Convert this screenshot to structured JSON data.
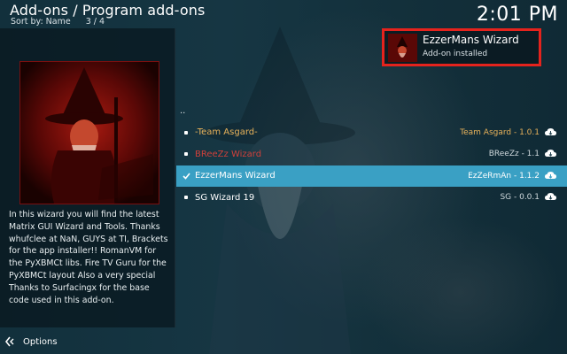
{
  "header": {
    "title": "Add-ons / Program add-ons",
    "sort_label": "Sort by: Name",
    "position": "3 / 4"
  },
  "clock": "2:01 PM",
  "selected_addon": {
    "description": "In this wizard you will find the latest Matrix GUI Wizard and Tools. Thanks whufclee at NaN, GUYS at TI, Brackets for the app installer!! RomanVM for the PyXBMCt libs. Fire TV Guru for the PyXBMCt layout  Also a very special Thanks to Surfacingx for the base code used in this add-on."
  },
  "list": {
    "parent": "..",
    "items": [
      {
        "name": "-Team Asgard-",
        "meta": "Team Asgard - 1.0.1",
        "state": "orange"
      },
      {
        "name": "BReeZz Wizard",
        "meta": "BReeZz - 1.1",
        "state": "red"
      },
      {
        "name": "EzzerMans Wizard",
        "meta": "EzZeRmAn - 1.1.2",
        "state": "selected"
      },
      {
        "name": "SG Wizard 19",
        "meta": "SG - 0.0.1",
        "state": "normal"
      }
    ]
  },
  "notification": {
    "title": "EzzerMans Wizard",
    "message": "Add-on installed"
  },
  "footer": {
    "options_label": "Options"
  },
  "colors": {
    "accent": "#3aa0c4",
    "orange": "#e8b25a",
    "red": "#d0403a",
    "toast_border": "#e5231d"
  },
  "icons": {
    "row_marker": "bullet-icon",
    "selected_marker": "check-icon",
    "install_source": "cloud-download-icon",
    "options": "options-arrows-icon"
  }
}
